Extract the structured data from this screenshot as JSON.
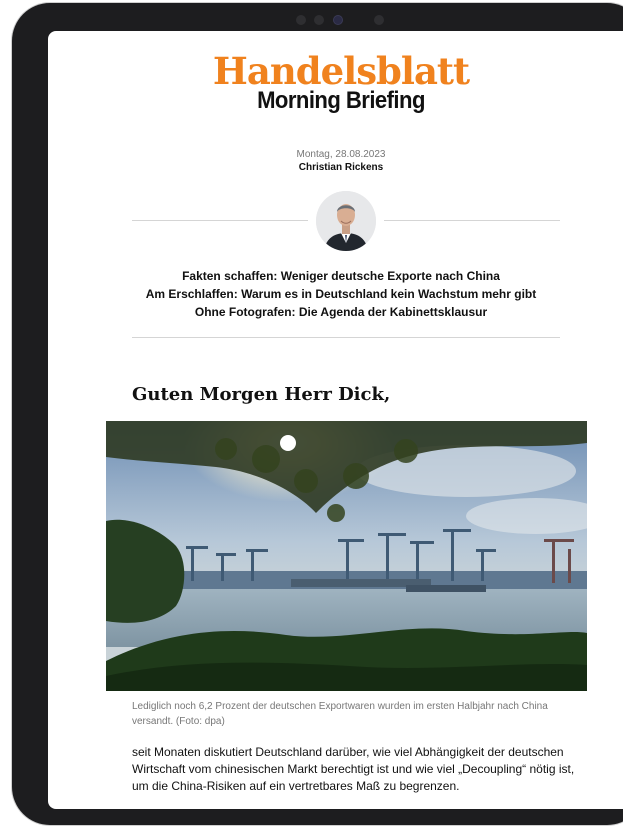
{
  "newsletter": {
    "brand": "Handelsblatt",
    "edition": "Morning Briefing",
    "date": "Montag, 28.08.2023",
    "author": "Christian Rickens",
    "headlines": [
      "Fakten schaffen: Weniger deutsche Exporte nach China",
      "Am Erschlaffen: Warum es in Deutschland kein Wachstum mehr gibt",
      "Ohne Fotografen: Die Agenda der Kabinettsklausur"
    ],
    "greeting": "Guten Morgen Herr Dick,",
    "image_caption": "Lediglich noch 6,2 Prozent der deutschen Exportwaren wurden im ersten Halbjahr nach China versandt. (Foto: dpa)",
    "body_text": "seit Monaten diskutiert Deutschland darüber, wie viel Abhängigkeit der deutschen Wirtschaft vom chinesischen Markt berechtigt ist und wie viel „Decoupling“ nötig ist, um die China-Risiken auf ein vertretbares Maß zu begrenzen."
  },
  "colors": {
    "brand_orange": "#f0821e",
    "device_frame": "#1d1d1f"
  }
}
